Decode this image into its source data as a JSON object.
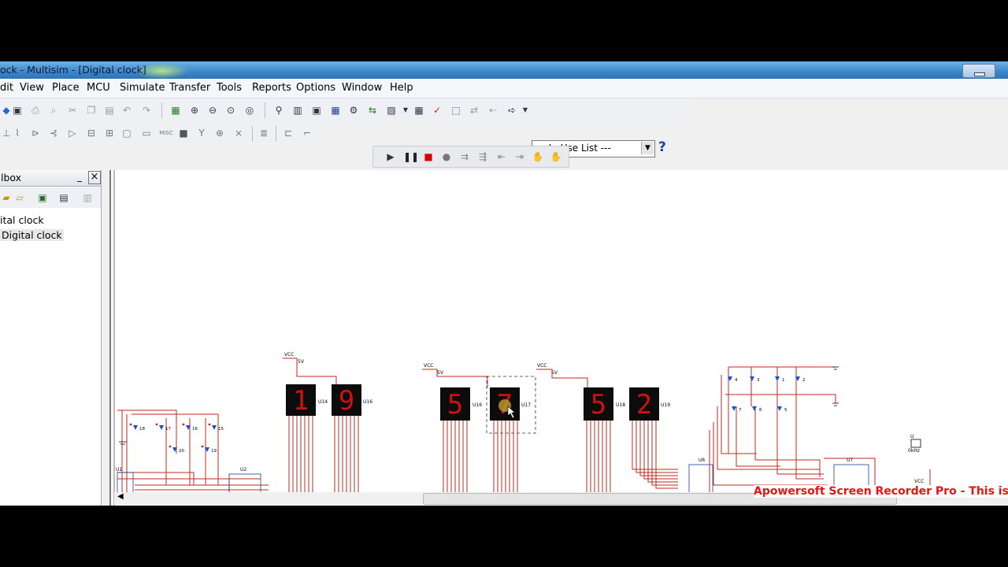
{
  "window": {
    "title": "ock - Multisim - [Digital clock]"
  },
  "menu": [
    "dit",
    "View",
    "Place",
    "MCU",
    "Simulate",
    "Transfer",
    "Tools",
    "Reports",
    "Options",
    "Window",
    "Help"
  ],
  "toolbar": {
    "in_use_list": "--- In Use List ---",
    "help_label": "?",
    "misc_label": "MISC"
  },
  "design_toolbox": {
    "title": "lbox",
    "pin_label": "_",
    "close_label": "×",
    "tree": [
      "ital clock",
      "Digital clock"
    ]
  },
  "schematic": {
    "vcc_labels": [
      "VCC",
      "VCC",
      "VCC",
      "VCC"
    ],
    "voltage_labels": [
      "5V",
      "5V",
      "5V"
    ],
    "displays": [
      {
        "digit": "1",
        "ref": "U14"
      },
      {
        "digit": "9",
        "ref": "U16"
      },
      {
        "digit": "5",
        "ref": "U16"
      },
      {
        "digit": "7",
        "ref": "U17"
      },
      {
        "digit": "5",
        "ref": "U18"
      },
      {
        "digit": "2",
        "ref": "U19"
      }
    ],
    "chip_labels": [
      "U1",
      "U2",
      "U6",
      "U7"
    ],
    "clock_ref": "U",
    "clock_freq": "0kHz",
    "led_refs": [
      "18",
      "17",
      "16",
      "15",
      "20",
      "19",
      "4",
      "3",
      "1",
      "2",
      "7",
      "6",
      "5"
    ]
  },
  "watermark": "Apowersoft Screen Recorder Pro - This is a tria"
}
